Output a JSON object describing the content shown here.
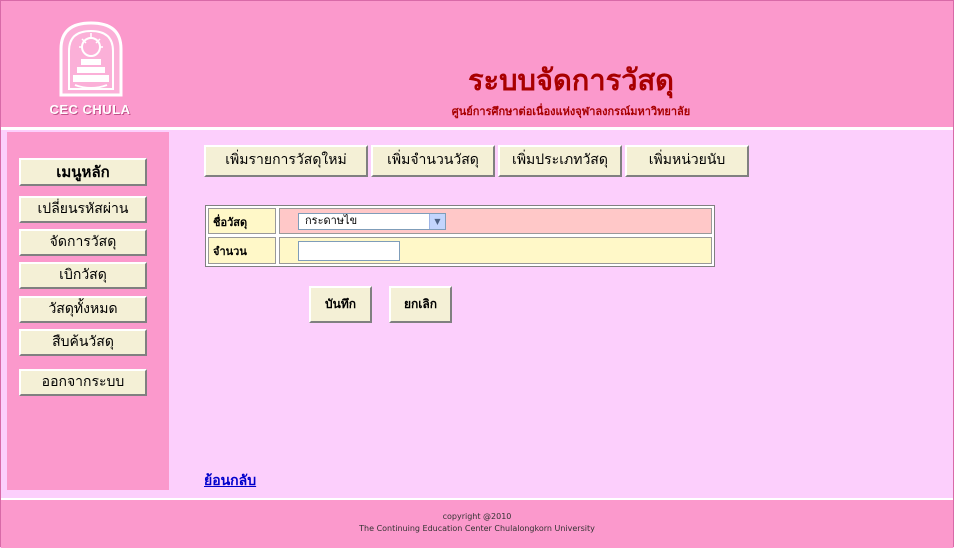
{
  "header": {
    "logo_text": "CEC CHULA",
    "title": "ระบบจัดการวัสดุ",
    "subtitle": "ศูนย์การศึกษาต่อเนื่องแห่งจุฬาลงกรณ์มหาวิทยาลัย"
  },
  "sidebar": {
    "heading": "เมนูหลัก",
    "items": [
      {
        "label": "เปลี่ยนรหัสผ่าน"
      },
      {
        "label": "จัดการวัสดุ"
      },
      {
        "label": "เบิกวัสดุ"
      },
      {
        "label": "วัสดุทั้งหมด"
      },
      {
        "label": "สืบค้นวัสดุ"
      },
      {
        "label": "ออกจากระบบ"
      }
    ]
  },
  "toolbar": {
    "buttons": [
      {
        "label": "เพิ่มรายการวัสดุใหม่"
      },
      {
        "label": "เพิ่มจำนวนวัสดุ"
      },
      {
        "label": "เพิ่มประเภทวัสดุ"
      },
      {
        "label": "เพิ่มหน่วยนับ"
      }
    ]
  },
  "form": {
    "item_label": "ชื่อวัสดุ",
    "item_value": "กระดาษไข",
    "qty_label": "จำนวน",
    "qty_value": "",
    "save_label": "บันทึก",
    "cancel_label": "ยกเลิก"
  },
  "back_link": "ย้อนกลับ",
  "footer": {
    "line1": "copyright @2010",
    "line2": "The Continuing Education Center Chulalongkorn University"
  },
  "colors": {
    "background": "#fccffc",
    "header": "#fb99cc",
    "title": "#a80000",
    "button": "#f4f0d6"
  }
}
